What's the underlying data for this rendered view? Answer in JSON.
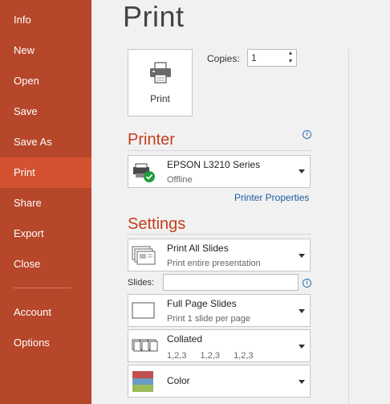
{
  "sidebar": {
    "items": [
      {
        "label": "Info"
      },
      {
        "label": "New"
      },
      {
        "label": "Open"
      },
      {
        "label": "Save"
      },
      {
        "label": "Save As"
      },
      {
        "label": "Print",
        "active": true
      },
      {
        "label": "Share"
      },
      {
        "label": "Export"
      },
      {
        "label": "Close"
      }
    ],
    "bottom_items": [
      {
        "label": "Account"
      },
      {
        "label": "Options"
      }
    ]
  },
  "main": {
    "title": "Print",
    "print_button": {
      "label": "Print",
      "icon": "printer-icon"
    },
    "copies": {
      "label": "Copies:",
      "value": "1"
    },
    "printer_section": {
      "heading": "Printer",
      "selected": {
        "name": "EPSON L3210 Series",
        "status": "Offline"
      },
      "properties_link": "Printer Properties"
    },
    "settings_section": {
      "heading": "Settings",
      "what_to_print": {
        "title": "Print All Slides",
        "subtitle": "Print entire presentation"
      },
      "slides": {
        "label": "Slides:",
        "value": ""
      },
      "layout": {
        "title": "Full Page Slides",
        "subtitle": "Print 1 slide per page"
      },
      "collation": {
        "title": "Collated",
        "sequence": [
          "1,2,3",
          "1,2,3",
          "1,2,3"
        ]
      },
      "color": {
        "title": "Color"
      }
    }
  },
  "colors": {
    "sidebar_bg": "#b7472a",
    "sidebar_active": "#d35230",
    "accent_heading": "#c43e1c",
    "link": "#1e5aa0"
  }
}
